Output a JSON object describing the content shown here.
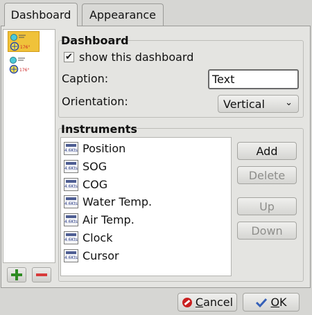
{
  "tabs": [
    {
      "label": "Dashboard"
    },
    {
      "label": "Appearance"
    }
  ],
  "dashboard": {
    "group_title": "Dashboard",
    "show_label": "show this dashboard",
    "show_checked": true,
    "caption_label": "Caption:",
    "caption_value": "Text",
    "orientation_label": "Orientation:",
    "orientation_value": "Vertical"
  },
  "instruments": {
    "group_title": "Instruments",
    "icon_text": "4.6Kts",
    "items": [
      "Position",
      "SOG",
      "COG",
      "Water Temp.",
      "Air Temp.",
      "Clock",
      "Cursor"
    ],
    "buttons": {
      "add": "Add",
      "delete": "Delete",
      "up": "Up",
      "down": "Down"
    }
  },
  "footer": {
    "cancel_prefix": "",
    "cancel_ul": "C",
    "cancel_rest": "ancel",
    "ok_ul": "O",
    "ok_rest": "K"
  },
  "colors": {
    "selection": "#f0c23a",
    "add_green": "#2e8b22",
    "remove_red": "#d83a3a",
    "cancel_red": "#c92020",
    "ok_blue": "#3560b8"
  }
}
